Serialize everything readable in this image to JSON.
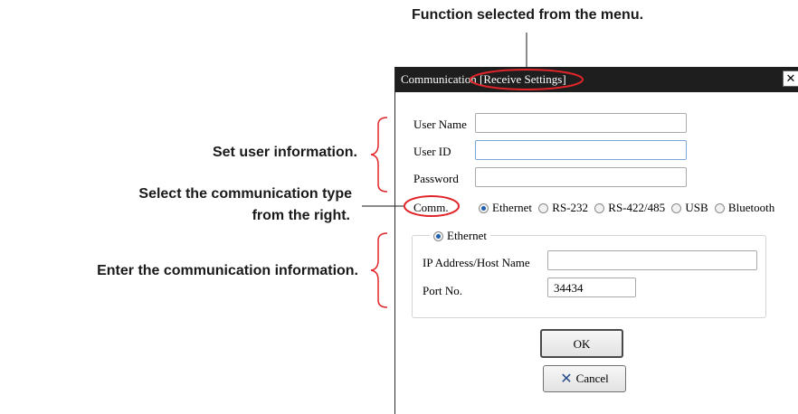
{
  "annotations": {
    "function": "Function selected from the menu.",
    "user_info": "Set user information.",
    "comm_type_line1": "Select the communication type",
    "comm_type_line2": "from the right.",
    "comm_info": "Enter the communication information."
  },
  "dialog": {
    "title": "Communication [Receive Settings]",
    "close_icon": "close-icon",
    "fields": {
      "user_name": {
        "label": "User Name",
        "value": ""
      },
      "user_id": {
        "label": "User ID",
        "value": ""
      },
      "password": {
        "label": "Password",
        "value": ""
      }
    },
    "comm": {
      "label": "Comm.",
      "options": [
        "Ethernet",
        "RS-232",
        "RS-422/485",
        "USB",
        "Bluetooth"
      ],
      "selected": "Ethernet"
    },
    "ethernet_group": {
      "legend": "Ethernet",
      "ip_label": "IP Address/Host Name",
      "ip_value": "",
      "port_label": "Port No.",
      "port_value": "34434"
    },
    "ok_label": "OK",
    "cancel_label": "Cancel",
    "cancel_icon": "x-icon"
  },
  "colors": {
    "highlight_ellipse": "#e0252a",
    "titlebar": "#1e1e1e",
    "radio_selected": "#1f5fb0"
  }
}
